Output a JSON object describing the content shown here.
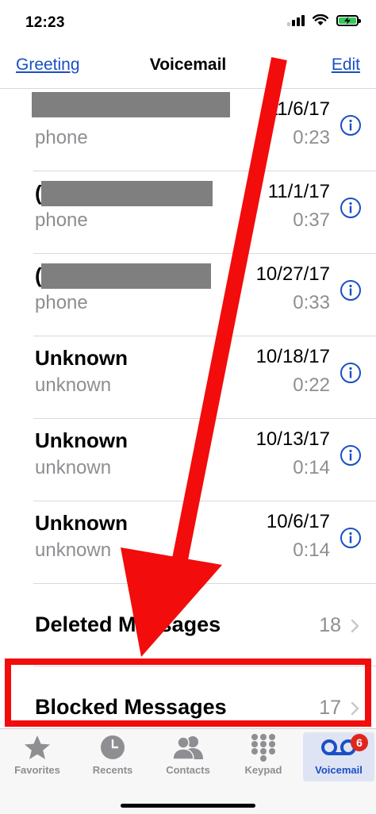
{
  "status": {
    "time": "12:23"
  },
  "nav": {
    "left": "Greeting",
    "title": "Voicemail",
    "right": "Edit"
  },
  "voicemails": [
    {
      "name": "",
      "label": "phone",
      "date": "11/6/17",
      "duration": "0:23",
      "redacted": true
    },
    {
      "name": "(",
      "label": "phone",
      "date": "11/1/17",
      "duration": "0:37",
      "redacted": true
    },
    {
      "name": "(",
      "label": "phone",
      "date": "10/27/17",
      "duration": "0:33",
      "redacted": true
    },
    {
      "name": "Unknown",
      "label": "unknown",
      "date": "10/18/17",
      "duration": "0:22"
    },
    {
      "name": "Unknown",
      "label": "unknown",
      "date": "10/13/17",
      "duration": "0:14"
    },
    {
      "name": "Unknown",
      "label": "unknown",
      "date": "10/6/17",
      "duration": "0:14"
    }
  ],
  "deleted": {
    "title": "Deleted Messages",
    "count": "18"
  },
  "blocked": {
    "title": "Blocked Messages",
    "count": "17"
  },
  "tabs": [
    {
      "label": "Favorites",
      "icon": "star-icon"
    },
    {
      "label": "Recents",
      "icon": "clock-icon"
    },
    {
      "label": "Contacts",
      "icon": "contacts-icon"
    },
    {
      "label": "Keypad",
      "icon": "keypad-icon"
    },
    {
      "label": "Voicemail",
      "icon": "voicemail-icon",
      "badge": "6"
    }
  ],
  "colors": {
    "accent": "#1a4fc4",
    "annotation": "#f20c0c",
    "badge": "#e0261c"
  }
}
